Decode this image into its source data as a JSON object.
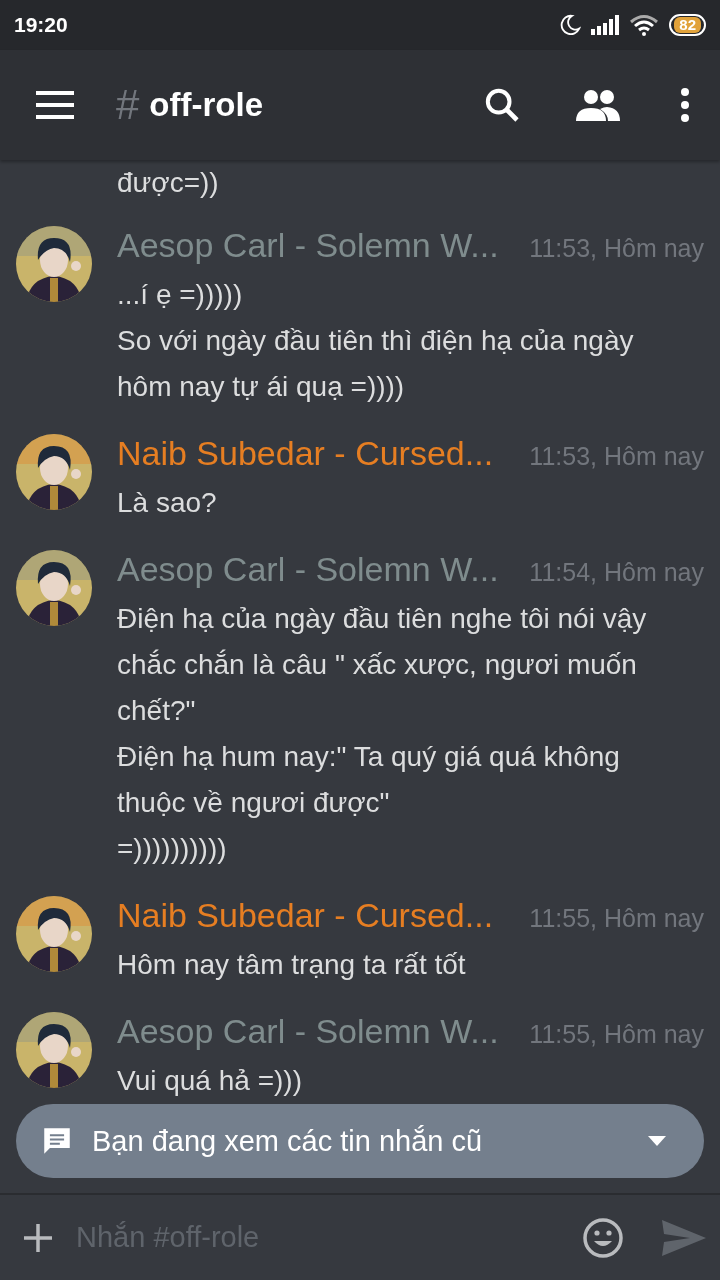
{
  "status_bar": {
    "time": "19:20",
    "battery": "82"
  },
  "header": {
    "hash": "#",
    "channel": "off-role"
  },
  "top_fragment": {
    "lines": [
      "được=))"
    ]
  },
  "messages": [
    {
      "author": "Aesop Carl - Solemn W...",
      "color": "#7f8c8d",
      "time": "11:53, Hôm nay",
      "lines": [
        "...í ẹ =)))))",
        "So với ngày đầu tiên thì điện hạ của ngày",
        "hôm nay tự ái quạ =))))"
      ]
    },
    {
      "author": "Naib Subedar - Cursed...",
      "color": "#e67e22",
      "time": "11:53, Hôm nay",
      "lines": [
        "Là sao?"
      ]
    },
    {
      "author": "Aesop Carl - Solemn W...",
      "color": "#7f8c8d",
      "time": "11:54, Hôm nay",
      "lines": [
        "Điện hạ của ngày đầu tiên nghe tôi nói vậy",
        "chắc chắn là câu \" xấc xược, ngươi muốn",
        "chết?\"",
        "Điện hạ hum nay:\" Ta quý giá quá không",
        "thuộc về ngươi được\"",
        "=))))))))))"
      ]
    },
    {
      "author": "Naib Subedar - Cursed...",
      "color": "#e67e22",
      "time": "11:55, Hôm nay",
      "lines": [
        "Hôm nay tâm trạng ta rất tốt"
      ]
    },
    {
      "author": "Aesop Carl - Solemn W...",
      "color": "#7f8c8d",
      "time": "11:55, Hôm nay",
      "lines": [
        "Vui quá hả =)))"
      ]
    }
  ],
  "banner": {
    "text": "Bạn đang xem các tin nhắn cũ"
  },
  "composer": {
    "placeholder": "Nhắn #off-role"
  }
}
